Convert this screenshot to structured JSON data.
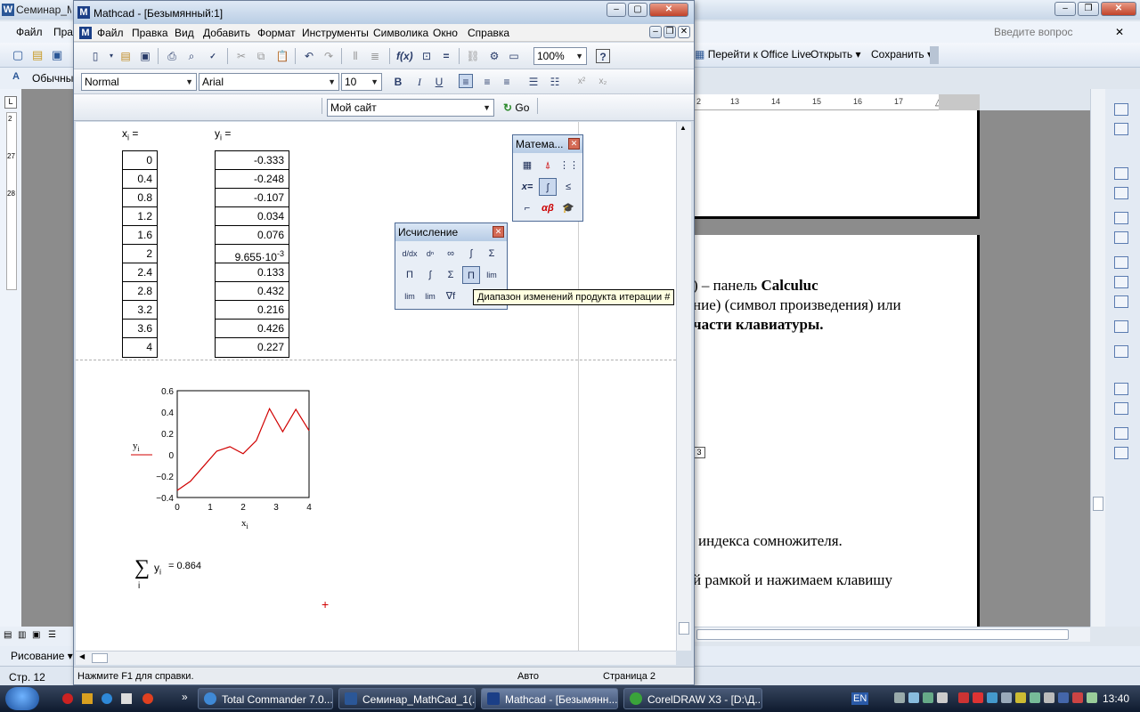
{
  "word": {
    "title": "Семинар_Ма",
    "menu": [
      "Файл",
      "Пра"
    ],
    "ask_placeholder": "Введите вопрос",
    "toolbar_buttons": [
      "Перейти к Office Live",
      "Открыть",
      "Сохранить"
    ],
    "style_box": "Обычный",
    "ruler_marks": [
      "2",
      "13",
      "14",
      "15",
      "16",
      "17"
    ],
    "left_ruler_marks": [
      "2",
      "27",
      "28"
    ],
    "doc_lines": {
      "l1_pre": ") – панель ",
      "l1_bold": "Calculuc",
      "l2": "ние) (символ произведения) или",
      "l3": "части клавиатуры.",
      "l4": "индекса сомножителя.",
      "l5": "й  рамкой  и  нажимаем  клавишу"
    },
    "float_marker": "3",
    "draw_menu": "Рисование",
    "status": {
      "page_label": "Стр. 12"
    }
  },
  "mathcad": {
    "title": "Mathcad - [Безымянный:1]",
    "menu": [
      "Файл",
      "Правка",
      "Вид",
      "Добавить",
      "Формат",
      "Инструменты",
      "Символика",
      "Окно",
      "Справка"
    ],
    "zoom": "100%",
    "style": "Normal",
    "font": "Arial",
    "font_size": "10",
    "url_combo": "Мой сайт",
    "go_label": "Go",
    "x_label": "x",
    "x_sub": "i",
    "y_label": "y",
    "y_sub": "i",
    "eq": "=",
    "x_values": [
      "0",
      "0.4",
      "0.8",
      "1.2",
      "1.6",
      "2",
      "2.4",
      "2.8",
      "3.2",
      "3.6",
      "4"
    ],
    "y_values": [
      "-0.333",
      "-0.248",
      "-0.107",
      "0.034",
      "0.076",
      "9.655·10",
      "0.133",
      "0.432",
      "0.216",
      "0.426",
      "0.227"
    ],
    "y_exp": "-3",
    "sum_expr": "y",
    "sum_sub": "i",
    "sum_idx": "i",
    "sum_result": "= 0.864",
    "status": {
      "help": "Нажмите F1 для справки.",
      "mode": "Авто",
      "page": "Страница 2"
    }
  },
  "palettes": {
    "math_title": "Матема...",
    "calc_title": "Исчисление",
    "tooltip": "Диапазон изменений продукта итерации #"
  },
  "chart_data": {
    "type": "line",
    "x": [
      0,
      0.4,
      0.8,
      1.2,
      1.6,
      2,
      2.4,
      2.8,
      3.2,
      3.6,
      4
    ],
    "series": [
      {
        "values": [
          -0.333,
          -0.248,
          -0.107,
          0.034,
          0.076,
          0.009655,
          0.133,
          0.432,
          0.216,
          0.426,
          0.227
        ]
      }
    ],
    "xlabel": "xi",
    "ylabel": "yi",
    "xlim": [
      0,
      4
    ],
    "ylim": [
      -0.4,
      0.6
    ],
    "xticks": [
      "0",
      "1",
      "2",
      "3",
      "4"
    ],
    "yticks": [
      "0.6",
      "0.4",
      "0.2",
      "0",
      "−0.2",
      "−0.4"
    ],
    "color": "#d00000"
  },
  "taskbar": {
    "items": [
      "Total Commander 7.0...",
      "Семинар_MathCad_1(...",
      "Mathcad - [Безымянн...",
      "CorelDRAW X3 - [D:\\Д..."
    ],
    "lang": "EN",
    "clock": "13:40"
  }
}
